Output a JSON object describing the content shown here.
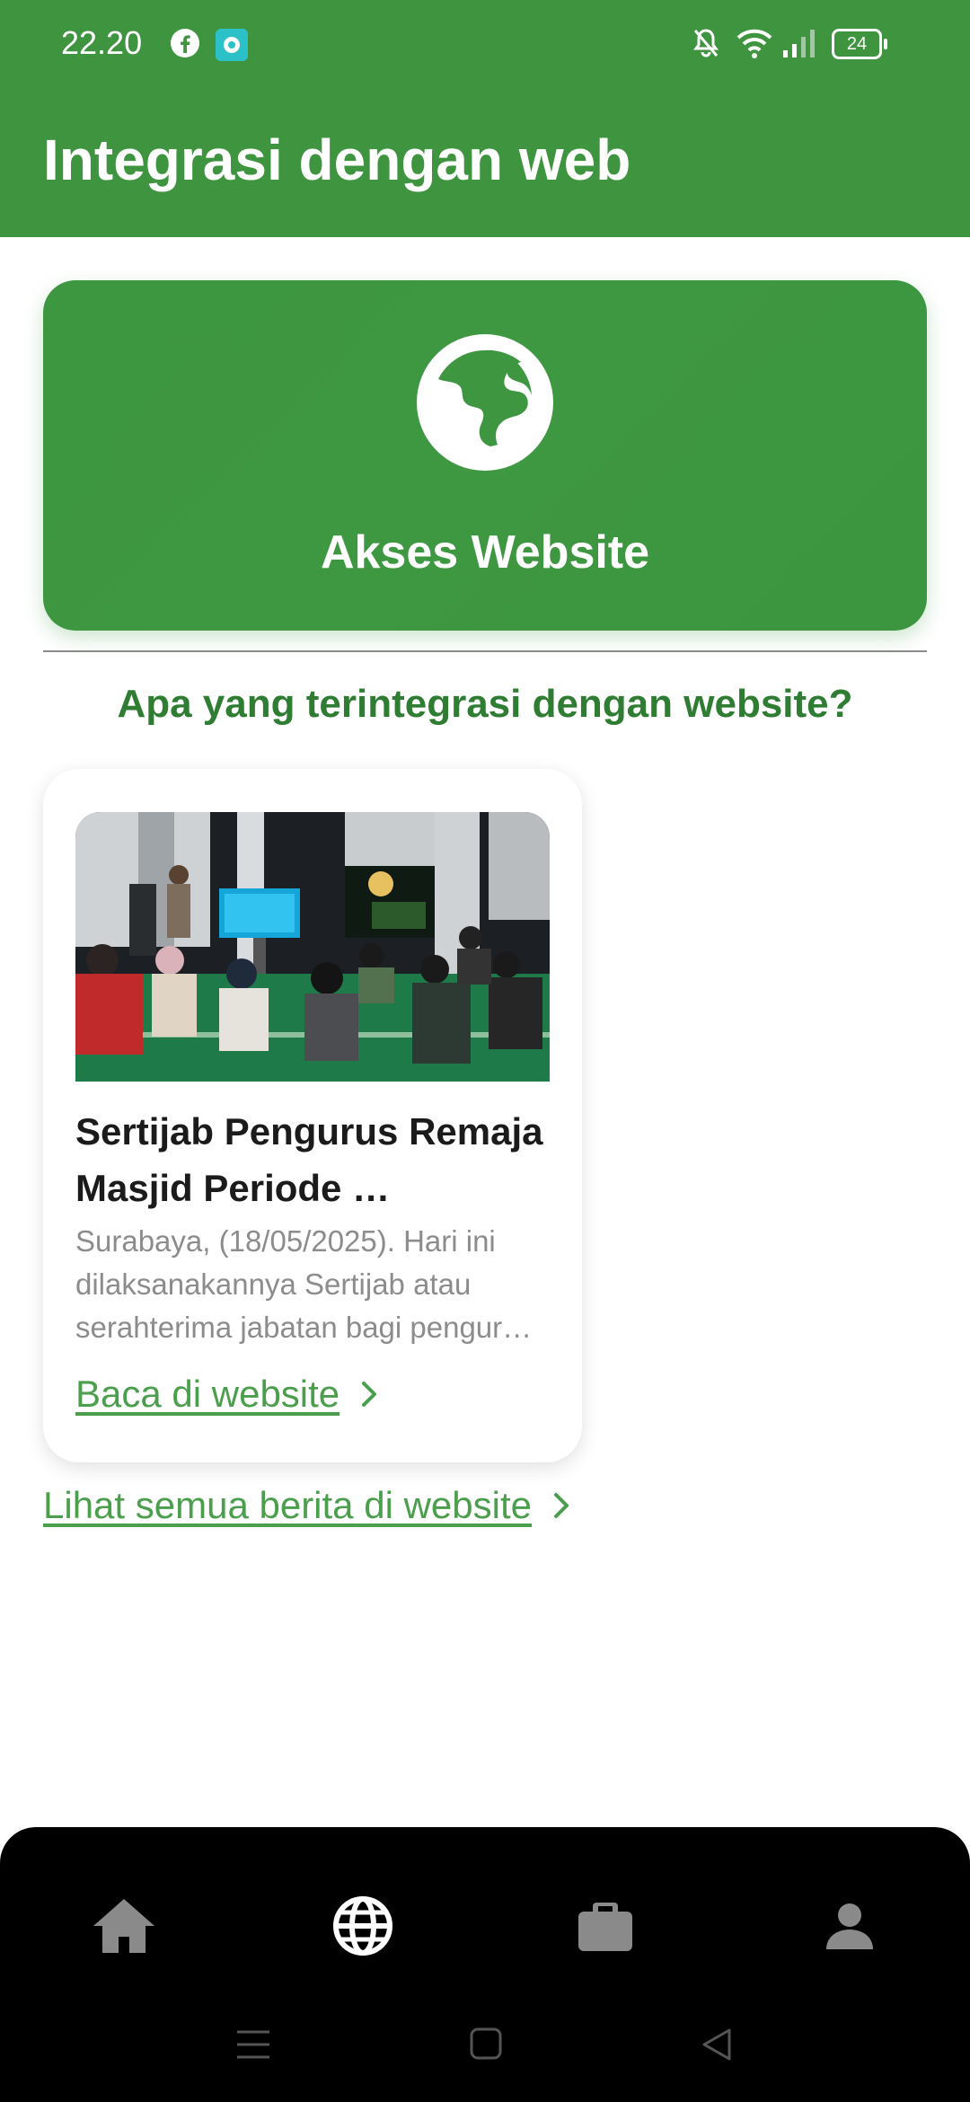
{
  "status_bar": {
    "time": "22.20",
    "battery": "24",
    "icons": [
      "facebook-icon",
      "chat-app-icon",
      "mute-icon",
      "wifi-icon",
      "signal-icon",
      "battery-icon"
    ]
  },
  "app_bar": {
    "title": "Integrasi dengan web"
  },
  "access_card": {
    "label": "Akses Website",
    "icon": "globe-icon"
  },
  "section": {
    "title": "Apa yang terintegrasi dengan website?"
  },
  "news": [
    {
      "title": "Sertijab Pengurus Remaja Masjid Periode …",
      "excerpt": "Surabaya, (18/05/2025). Hari ini dilaksanakannya Sertijab atau serahterima jabatan bagi pengur…",
      "link_label": "Baca di website"
    }
  ],
  "all_news_link": "Lihat semua berita di website",
  "bottom_nav": {
    "items": [
      {
        "icon": "home-icon",
        "active": false
      },
      {
        "icon": "web-globe-icon",
        "active": true
      },
      {
        "icon": "briefcase-icon",
        "active": false
      },
      {
        "icon": "profile-icon",
        "active": false
      }
    ]
  },
  "colors": {
    "primary": "#3f943f",
    "accent_text": "#2e7d32",
    "link": "#4a9e4c",
    "nav_bg": "#000000",
    "nav_inactive": "#8a8a8a",
    "nav_active": "#ffffff"
  }
}
